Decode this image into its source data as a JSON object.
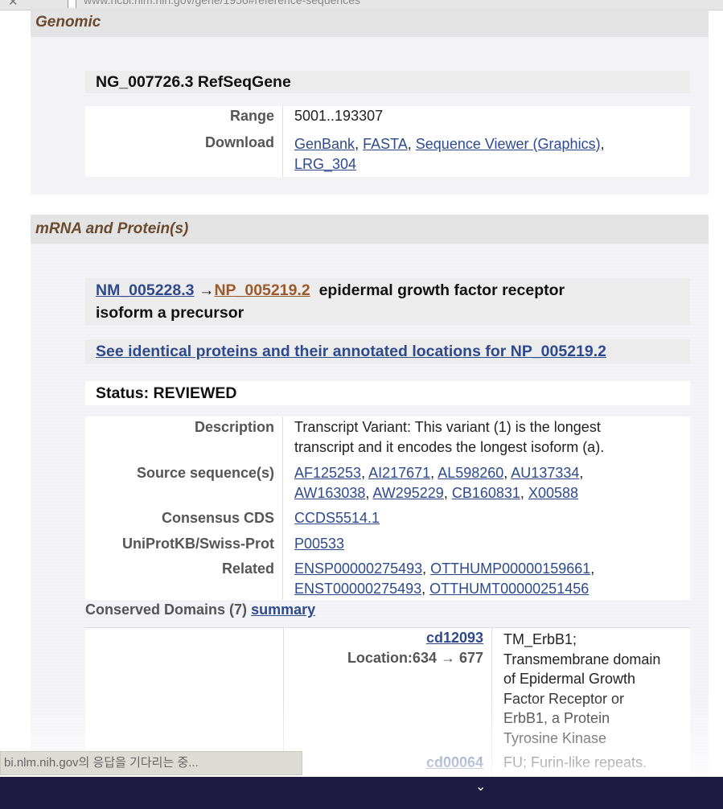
{
  "browser": {
    "url": "www.ncbi.nlm.nih.gov/gene/1956#reference-sequences",
    "status_text": "bi.nlm.nih.gov의 응답을 기다리는 중..."
  },
  "genomic": {
    "header": "Genomic",
    "title": "NG_007726.3 RefSeqGene",
    "range_label": "Range",
    "range_value": "5001..193307",
    "download_label": "Download",
    "downloads": [
      "GenBank",
      "FASTA",
      "Sequence Viewer (Graphics)",
      "LRG_304"
    ]
  },
  "mrna": {
    "header": "mRNA and Protein(s)",
    "nm_link": "NM_005228.3",
    "arrow": "→",
    "np_link": "NP_005219.2",
    "title_text": "epidermal growth factor receptor",
    "title_text2": "isoform a precursor",
    "identical_link": "See identical proteins and their annotated locations for NP_005219.2",
    "status": "Status: REVIEWED",
    "description_label": "Description",
    "description_line1": "Transcript Variant: This variant (1) is the longest",
    "description_line2": "transcript and it encodes the longest isoform (a).",
    "source_label": "Source sequence(s)",
    "sources": [
      "AF125253",
      "AI217671",
      "AL598260",
      "AU137334",
      "AW163038",
      "AW295229",
      "CB160831",
      "X00588"
    ],
    "ccds_label": "Consensus CDS",
    "ccds": "CCDS5514.1",
    "uniprot_label": "UniProtKB/Swiss-Prot",
    "uniprot": "P00533",
    "related_label": "Related",
    "related": [
      "ENSP00000275493",
      "OTTHUMP00000159661",
      "ENST00000275493",
      "OTTHUMT00000251456"
    ],
    "conserved_label": "Conserved Domains (7)",
    "conserved_summary": "summary",
    "domains": [
      {
        "id": "cd12093",
        "location": "Location:634 → 677",
        "desc_lines": [
          "TM_ErbB1;",
          "Transmembrane domain",
          "of Epidermal Growth",
          "Factor Receptor or",
          "ErbB1, a Protein",
          "Tyrosine Kinase"
        ]
      },
      {
        "id": "cd00064",
        "desc_lines": [
          "FU; Furin-like repeats."
        ]
      }
    ]
  }
}
